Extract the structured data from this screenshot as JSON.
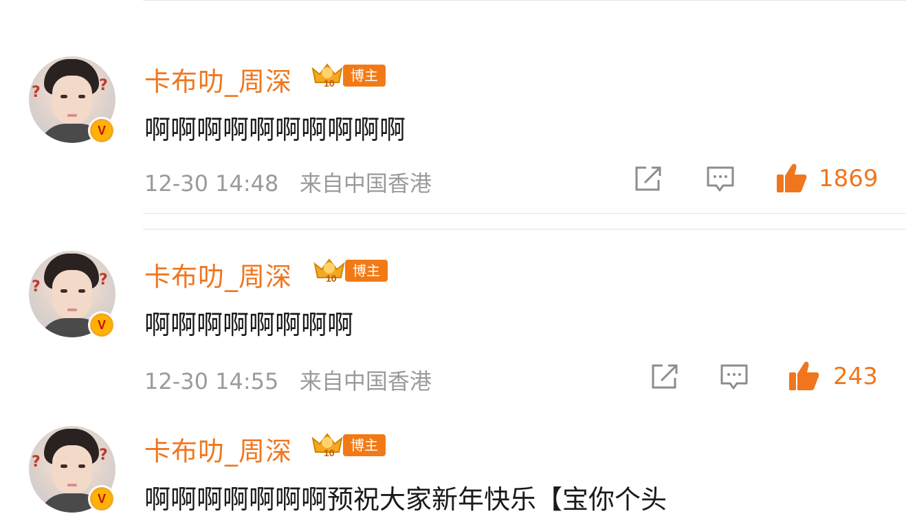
{
  "comments": [
    {
      "username": "卡布叻_周深",
      "badge": "博主",
      "level": "10",
      "text": "啊啊啊啊啊啊啊啊啊啊",
      "time": "12-30 14:48",
      "location": "来自中国香港",
      "likes": "1869"
    },
    {
      "username": "卡布叻_周深",
      "badge": "博主",
      "level": "10",
      "text": "啊啊啊啊啊啊啊啊",
      "time": "12-30 14:55",
      "location": "来自中国香港",
      "likes": "243"
    },
    {
      "username": "卡布叻_周深",
      "badge": "博主",
      "level": "10",
      "text": "啊啊啊啊啊啊啊预祝大家新年快乐【宝你个头"
    }
  ],
  "verified_mark": "V",
  "colors": {
    "accent": "#f0761e",
    "meta": "#9a9a9a",
    "text": "#1a1a1a"
  },
  "icons": [
    "share-icon",
    "comment-icon",
    "like-thumb-icon",
    "verified-badge-icon",
    "crown-level-icon"
  ]
}
